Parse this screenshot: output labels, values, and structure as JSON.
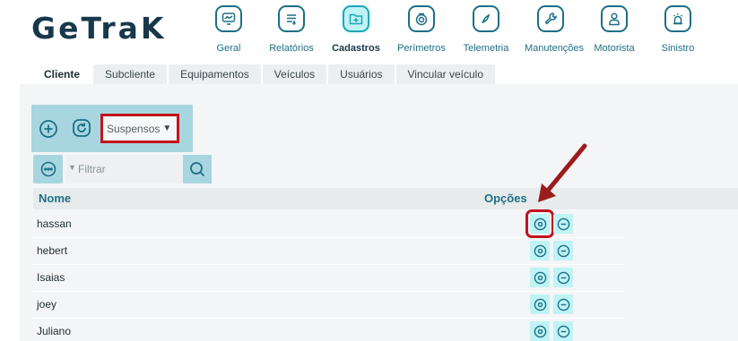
{
  "brand": {
    "logo_text": "GeTraK"
  },
  "nav": {
    "items": [
      {
        "label": "Geral",
        "icon": "monitor-chart-icon",
        "active": false
      },
      {
        "label": "Relatórios",
        "icon": "report-list-icon",
        "active": false
      },
      {
        "label": "Cadastros",
        "icon": "folder-add-icon",
        "active": true
      },
      {
        "label": "Perímetros",
        "icon": "target-pin-icon",
        "active": false
      },
      {
        "label": "Telemetria",
        "icon": "compass-icon",
        "active": false
      },
      {
        "label": "Manutenções",
        "icon": "wrench-icon",
        "active": false
      },
      {
        "label": "Motorista",
        "icon": "driver-icon",
        "active": false
      },
      {
        "label": "Sinistro",
        "icon": "alarm-icon",
        "active": false
      }
    ]
  },
  "tabs": [
    {
      "label": "Cliente",
      "active": true
    },
    {
      "label": "Subcliente",
      "active": false
    },
    {
      "label": "Equipamentos",
      "active": false
    },
    {
      "label": "Veículos",
      "active": false
    },
    {
      "label": "Usuários",
      "active": false
    },
    {
      "label": "Vincular veículo",
      "active": false
    }
  ],
  "toolbar": {
    "add_icon": "plus-circle-icon",
    "refresh_icon": "refresh-icon",
    "status_select": {
      "value": "Suspensos",
      "icon": "chevron-down-icon"
    }
  },
  "filter": {
    "toggle_icon": "more-options-icon",
    "placeholder": "Filtrar",
    "search_icon": "search-icon"
  },
  "table": {
    "columns": {
      "name": "Nome",
      "options": "Opções"
    },
    "rows": [
      {
        "name": "hassan"
      },
      {
        "name": "hebert"
      },
      {
        "name": "Isaias"
      },
      {
        "name": "joey"
      },
      {
        "name": "Juliano"
      }
    ],
    "row_actions": {
      "view_icon": "eye-icon",
      "remove_icon": "minus-circle-icon"
    }
  },
  "colors": {
    "primary": "#1d6f86",
    "toolbar_bg": "#a8d6e0",
    "active_icon_bg": "#bff3f6",
    "annotation": "#c0141c",
    "logo": "#17384a"
  }
}
